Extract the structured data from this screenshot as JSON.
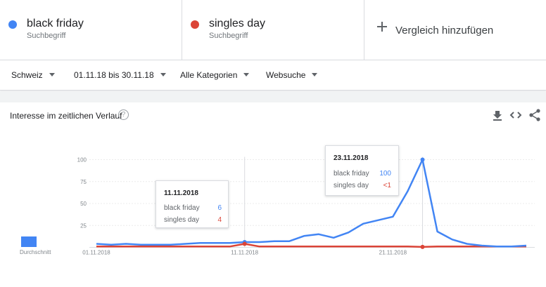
{
  "terms": [
    {
      "name": "black friday",
      "subtitle": "Suchbegriff",
      "color": "#4285f4"
    },
    {
      "name": "singles day",
      "subtitle": "Suchbegriff",
      "color": "#db4437"
    }
  ],
  "add_compare": {
    "label": "Vergleich hinzufügen"
  },
  "filters": {
    "region": "Schweiz",
    "date_range": "01.11.18 bis 30.11.18",
    "category": "Alle Kategorien",
    "search_type": "Websuche"
  },
  "panel": {
    "title": "Interesse im zeitlichen Verlauf"
  },
  "icons": {
    "help": "help-circle-icon",
    "download": "download-icon",
    "embed": "embed-code-icon",
    "share": "share-icon"
  },
  "average": {
    "label": "Durchschnitt",
    "value": 3
  },
  "tooltips": [
    {
      "date": "11.11.2018",
      "rows": [
        {
          "label": "black friday",
          "value": "6",
          "color": "#4285f4"
        },
        {
          "label": "singles day",
          "value": "4",
          "color": "#db4437"
        }
      ]
    },
    {
      "date": "23.11.2018",
      "rows": [
        {
          "label": "black friday",
          "value": "100",
          "color": "#4285f4"
        },
        {
          "label": "singles day",
          "value": "<1",
          "color": "#db4437"
        }
      ]
    }
  ],
  "chart_data": {
    "type": "line",
    "x": [
      "01.11.2018",
      "02.11.2018",
      "03.11.2018",
      "04.11.2018",
      "05.11.2018",
      "06.11.2018",
      "07.11.2018",
      "08.11.2018",
      "09.11.2018",
      "10.11.2018",
      "11.11.2018",
      "12.11.2018",
      "13.11.2018",
      "14.11.2018",
      "15.11.2018",
      "16.11.2018",
      "17.11.2018",
      "18.11.2018",
      "19.11.2018",
      "20.11.2018",
      "21.11.2018",
      "22.11.2018",
      "23.11.2018",
      "24.11.2018",
      "25.11.2018",
      "26.11.2018",
      "27.11.2018",
      "28.11.2018",
      "29.11.2018",
      "30.11.2018"
    ],
    "x_tick_labels": [
      "01.11.2018",
      "11.11.2018",
      "21.11.2018"
    ],
    "y_ticks": [
      25,
      50,
      75,
      100
    ],
    "ylim": [
      0,
      100
    ],
    "series": [
      {
        "name": "black friday",
        "color": "#4285f4",
        "values": [
          4,
          3,
          4,
          3,
          3,
          3,
          4,
          5,
          5,
          5,
          6,
          6,
          7,
          7,
          13,
          15,
          11,
          17,
          27,
          31,
          35,
          64,
          100,
          18,
          9,
          4,
          2,
          1,
          1,
          2
        ]
      },
      {
        "name": "singles day",
        "color": "#db4437",
        "values": [
          1,
          1,
          1,
          1,
          1,
          1,
          1,
          1,
          1,
          1,
          4,
          1,
          1,
          1,
          1,
          1,
          1,
          1,
          1,
          1,
          1,
          1,
          0.5,
          1,
          1,
          1,
          1,
          1,
          1,
          1
        ]
      }
    ],
    "highlighted_x": [
      "11.11.2018",
      "23.11.2018"
    ],
    "grid": true,
    "legend": "top"
  }
}
